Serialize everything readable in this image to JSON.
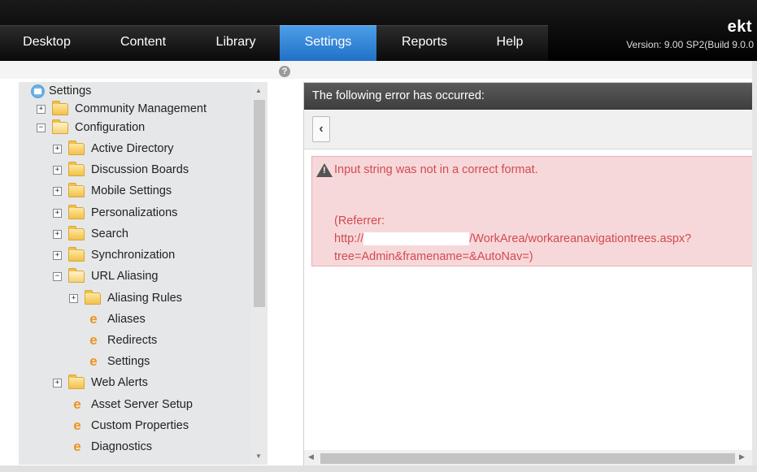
{
  "header": {
    "brand": "ekt",
    "version": "Version: 9.00 SP2(Build 9.0.0",
    "tabs": [
      {
        "label": "Desktop"
      },
      {
        "label": "Content"
      },
      {
        "label": "Library"
      },
      {
        "label": "Settings",
        "active": true
      },
      {
        "label": "Reports"
      },
      {
        "label": "Help"
      }
    ]
  },
  "tree": {
    "root": "Settings",
    "items": [
      {
        "label": "Community Management",
        "level": 1,
        "type": "folder",
        "expander": "+"
      },
      {
        "label": "Configuration",
        "level": 1,
        "type": "folder-open",
        "expander": "−"
      },
      {
        "label": "Active Directory",
        "level": 2,
        "type": "folder",
        "expander": "+"
      },
      {
        "label": "Discussion Boards",
        "level": 2,
        "type": "folder",
        "expander": "+"
      },
      {
        "label": "Mobile Settings",
        "level": 2,
        "type": "folder",
        "expander": "+"
      },
      {
        "label": "Personalizations",
        "level": 2,
        "type": "folder",
        "expander": "+"
      },
      {
        "label": "Search",
        "level": 2,
        "type": "folder",
        "expander": "+"
      },
      {
        "label": "Synchronization",
        "level": 2,
        "type": "folder",
        "expander": "+"
      },
      {
        "label": "URL Aliasing",
        "level": 2,
        "type": "folder-open",
        "expander": "−"
      },
      {
        "label": "Aliasing Rules",
        "level": 3,
        "type": "folder",
        "expander": "+"
      },
      {
        "label": "Aliases",
        "level": 3,
        "type": "page"
      },
      {
        "label": "Redirects",
        "level": 3,
        "type": "page"
      },
      {
        "label": "Settings",
        "level": 3,
        "type": "page"
      },
      {
        "label": "Web Alerts",
        "level": 2,
        "type": "folder",
        "expander": "+"
      },
      {
        "label": "Asset Server Setup",
        "level": 2,
        "type": "page"
      },
      {
        "label": "Custom Properties",
        "level": 2,
        "type": "page"
      },
      {
        "label": "Diagnostics",
        "level": 2,
        "type": "page"
      }
    ]
  },
  "error": {
    "title": "The following error has occurred:",
    "message": "Input string was not in a correct format.",
    "referrer_label": "(Referrer:",
    "referrer_prefix": "http://",
    "referrer_path": "/WorkArea/workareanavigationtrees.aspx?",
    "referrer_query": "tree=Admin&framename=&AutoNav=)"
  },
  "icons": {
    "help": "help-icon",
    "back": "chevron-left-icon",
    "warning": "warning-icon",
    "folder": "folder-icon",
    "page": "ektron-page-icon"
  },
  "colors": {
    "nav_active": "#2f82d8",
    "error_bg": "#f7d8da",
    "error_text": "#d24a4f",
    "page_icon": "#f0921d"
  }
}
